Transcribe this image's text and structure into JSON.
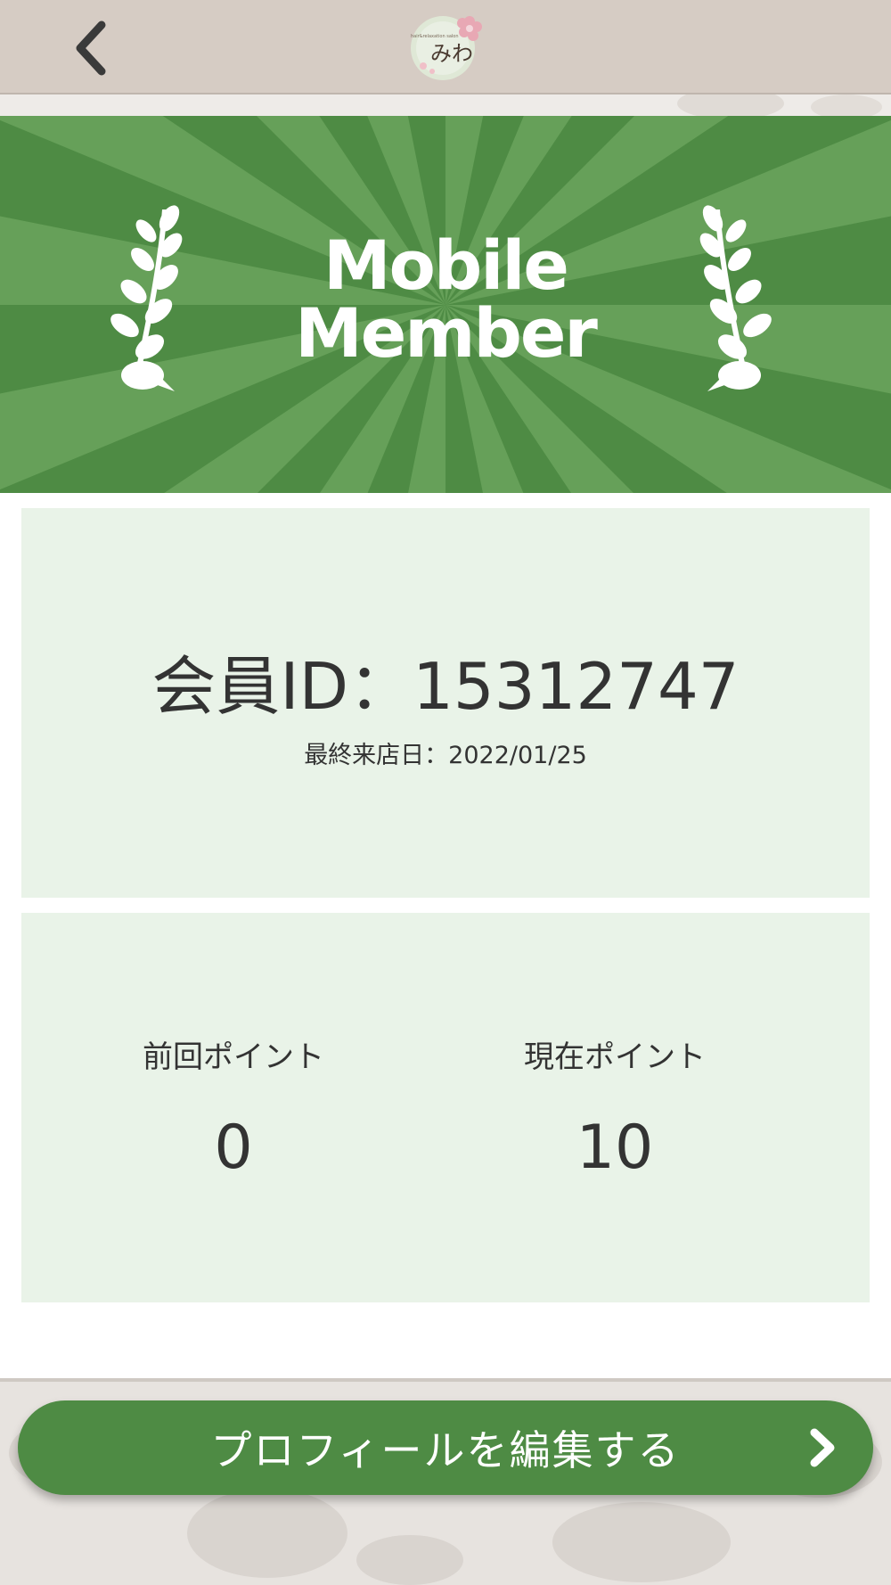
{
  "header": {
    "back_icon": "chevron-left-icon",
    "logo_text": "みわ",
    "logo_subtext": "hair&relaxation salon"
  },
  "banner": {
    "title_line1": "Mobile",
    "title_line2": "Member",
    "decoration_icon": "laurel-icon",
    "colors": {
      "background": "#4e8b44",
      "ray": "#66a059"
    }
  },
  "member": {
    "id_text": "会員ID：15312747",
    "last_visit_text": "最終来店日：2022/01/25"
  },
  "points": {
    "previous_label": "前回ポイント",
    "previous_value": "0",
    "current_label": "現在ポイント",
    "current_value": "10"
  },
  "footer": {
    "edit_profile_label": "プロフィールを編集する",
    "edit_icon": "chevron-right-icon"
  },
  "colors": {
    "accent": "#4e8b44",
    "card": "#e9f3e8",
    "header": "#d6ccc4",
    "text": "#333333"
  }
}
